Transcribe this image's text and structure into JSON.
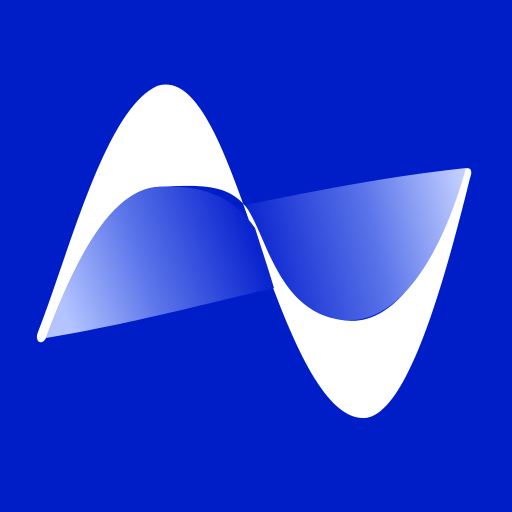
{
  "icon": {
    "name": "wave-logo-icon",
    "colors": {
      "background": "#001ec8",
      "wave_primary": "#ffffff",
      "wave_shadow_light": "#b4c4ff",
      "wave_shadow_mid": "#4b66e6",
      "wave_shadow_dark": "#0a24cf"
    }
  }
}
